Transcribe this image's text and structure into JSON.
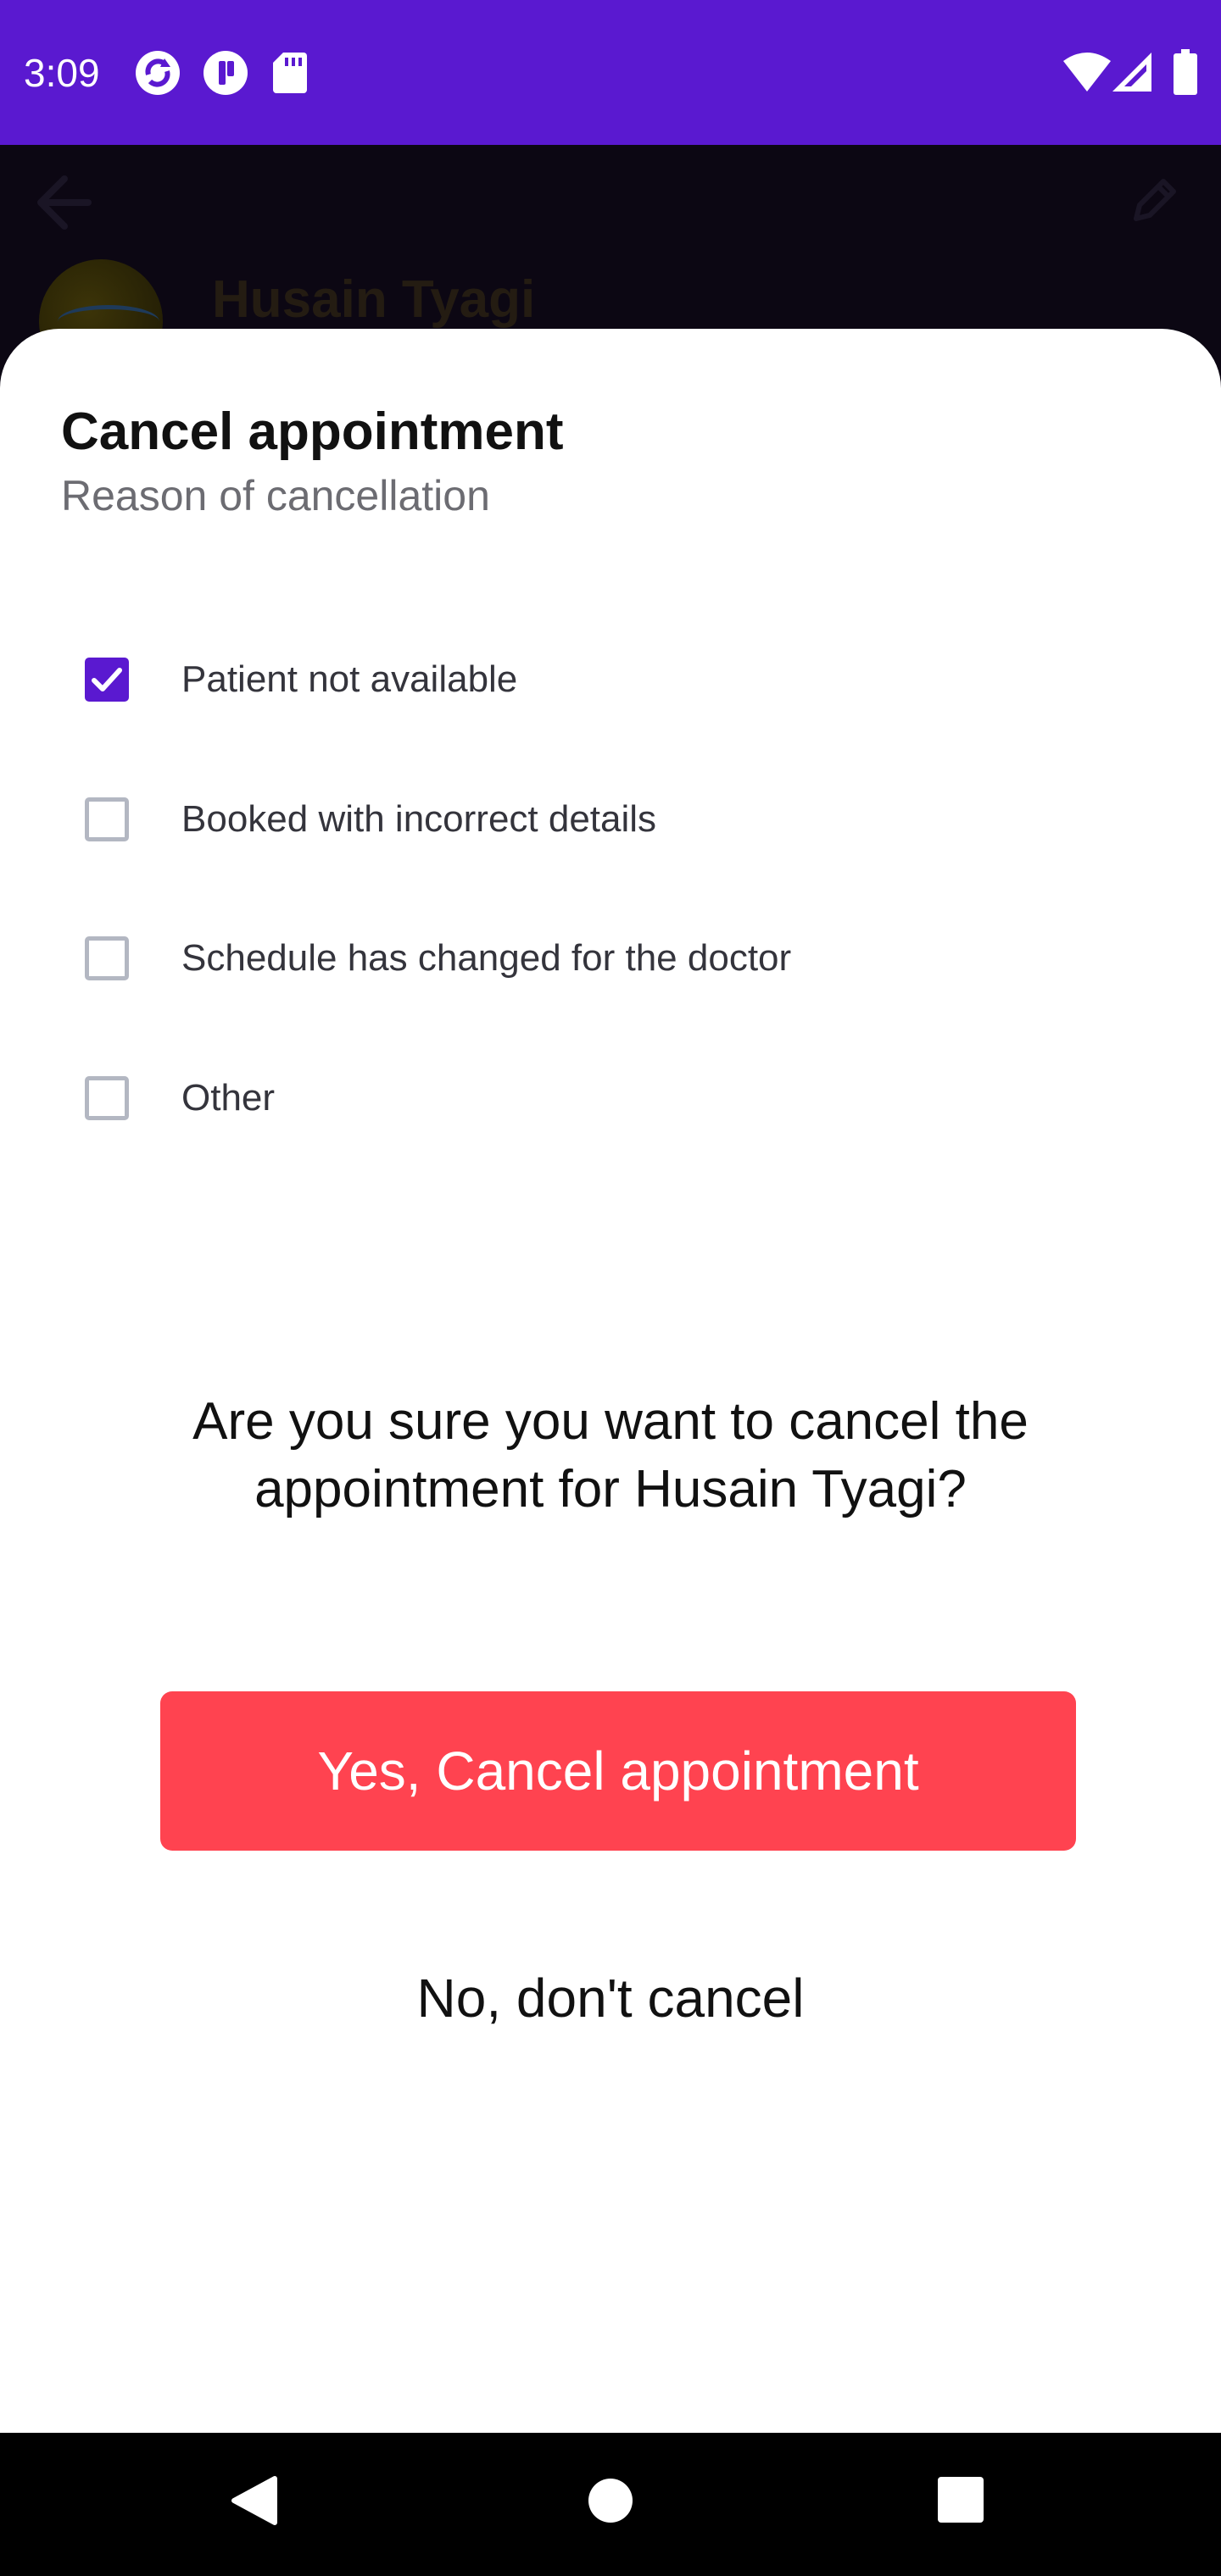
{
  "status_bar": {
    "time": "3:09",
    "left_icons": [
      "sync-icon",
      "pocket-icon",
      "sd-card-icon"
    ],
    "right_icons": [
      "wifi-icon",
      "signal-icon",
      "battery-icon"
    ],
    "color": "#5a19d0"
  },
  "background_screen": {
    "name": "Husain Tyagi",
    "icons": [
      "back-arrow-icon",
      "edit-pencil-icon"
    ]
  },
  "sheet": {
    "title": "Cancel appointment",
    "subtitle": "Reason of cancellation",
    "reasons": [
      {
        "label": "Patient not available",
        "checked": true
      },
      {
        "label": "Booked with incorrect details",
        "checked": false
      },
      {
        "label": "Schedule has changed for the doctor",
        "checked": false
      },
      {
        "label": "Other",
        "checked": false
      }
    ],
    "confirm_text": "Are you sure you want to cancel the appointment for Husain  Tyagi?",
    "yes_button": "Yes, Cancel appointment",
    "no_button": "No, don't cancel",
    "accent_color": "#5a19d0",
    "danger_color": "#ff4350"
  },
  "nav_bar": {
    "buttons": [
      "back-icon",
      "home-icon",
      "recents-icon"
    ]
  }
}
